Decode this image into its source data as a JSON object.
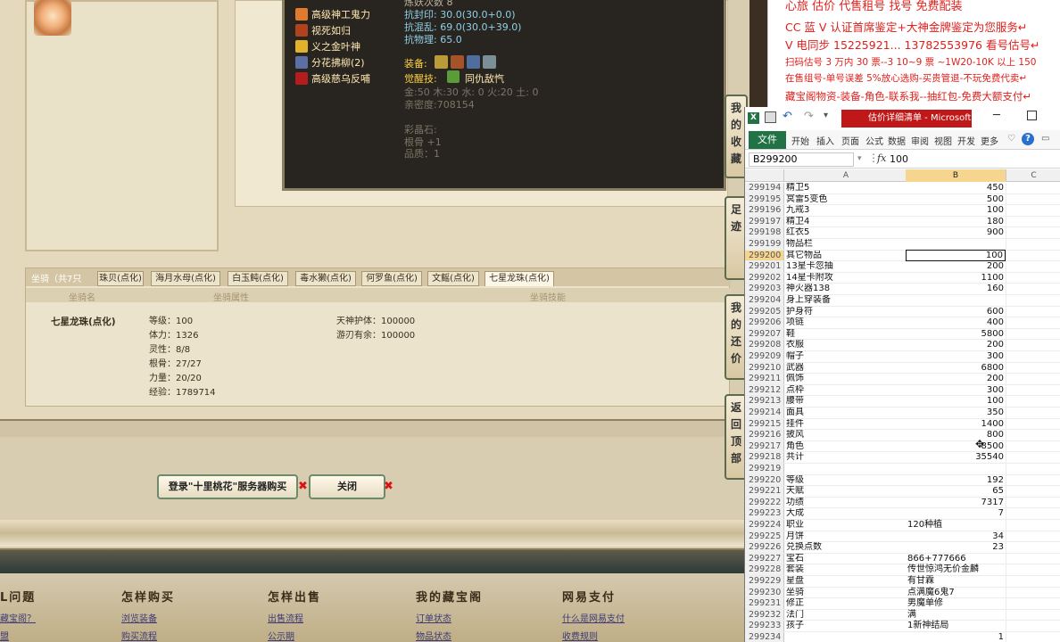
{
  "promo": {
    "line0": "心旅 估价 代售租号 找号 免费配装",
    "line1": "CC 蓝 V 认证首席鉴定+大神金牌鉴定为您服务↵",
    "line2": "V 电同步 15225921... 13782553976 看号估号↵",
    "line3": "扫码估号 3 万内 30 票--3 10~9 票 ~1W20-10K 以上 150",
    "line4": "在售组号-单号误差 5%放心选购-买贵管退-不玩免费代卖↵",
    "line5": "藏宝阁物资-装备-角色-联系我--抽红包-免费大额支付↵"
  },
  "tooltip": {
    "top_partial": "炼妖次数 8",
    "skills": [
      "高级神工鬼力",
      "视死如归",
      "义之金叶神",
      "分花拂柳(2)",
      "高级慈乌反哺"
    ],
    "stats": [
      "抗封印: 30.0(30.0+0.0)",
      "抗混乱: 69.0(30.0+39.0)",
      "抗物理: 65.0"
    ],
    "equip_label": "装备:",
    "awaken_label": "觉醒技:",
    "awaken_value": "同仇敌忾",
    "elements": "金:50 木:30 水: 0 火:20 土: 0",
    "intimacy": "亲密度:708154",
    "crystal_label": "彩晶石:",
    "crystal_1": "根骨 +1",
    "crystal_2": "品质：1"
  },
  "horse": {
    "count_label": "坐骑（共7只",
    "tabs": [
      "珠贝(点化)",
      "海月水母(点化)",
      "白玉鲀(点化)",
      "毒水獭(点化)",
      "何罗鱼(点化)",
      "文鳐(点化)",
      "七星龙珠(点化)"
    ],
    "head": [
      "坐骑名",
      "坐骑属性",
      "坐骑技能"
    ],
    "name": "七星龙珠(点化)",
    "attrs": [
      "等级：100",
      "体力：1326",
      "灵性：8/8",
      "根骨：27/27",
      "力量：20/20",
      "经验：1789714"
    ],
    "skills": [
      "天神护体：100000",
      "游刃有余：100000"
    ]
  },
  "buttons": {
    "buy": "登录\"十里桃花\"服务器购买",
    "close": "关闭"
  },
  "sidetabs": [
    "我的收藏",
    "足迹",
    "我的还价",
    "返回顶部"
  ],
  "footer": {
    "cols": [
      "L问题",
      "怎样购买",
      "怎样出售",
      "我的藏宝阁",
      "网易支付"
    ],
    "links": [
      "藏宝阁？",
      "浏览装备",
      "出售流程",
      "订单状态",
      "什么是网易支付",
      "购买流程",
      "公示期",
      "物品状态",
      "收费规则",
      "盟"
    ]
  },
  "excel": {
    "title": "估价详细清单 - Microsoft...",
    "ribbon": [
      "文件",
      "开始",
      "插入",
      "页面",
      "公式",
      "数据",
      "审阅",
      "视图",
      "开发",
      "更多"
    ],
    "namebox": "B299200",
    "fx": "fx",
    "formula": "100",
    "cols": [
      "A",
      "B",
      "C"
    ],
    "selected_row": "299200",
    "rows": [
      [
        "299194",
        "精卫5",
        "450"
      ],
      [
        "299195",
        "冥雷5变色",
        "500"
      ],
      [
        "299196",
        "九戒3",
        "100"
      ],
      [
        "299197",
        "精卫4",
        "180"
      ],
      [
        "299198",
        "红衣5",
        "900"
      ],
      [
        "299199",
        "物品栏",
        ""
      ],
      [
        "299200",
        "其它物品",
        "100"
      ],
      [
        "299201",
        "13星卡忽抽",
        "200"
      ],
      [
        "299202",
        "14星卡附攻",
        "1100"
      ],
      [
        "299203",
        "神火器138",
        "160"
      ],
      [
        "299204",
        "身上穿装备",
        ""
      ],
      [
        "299205",
        "护身符",
        "600"
      ],
      [
        "299206",
        "项链",
        "400"
      ],
      [
        "299207",
        "鞋",
        "5800"
      ],
      [
        "299208",
        "衣服",
        "200"
      ],
      [
        "299209",
        "帽子",
        "300"
      ],
      [
        "299210",
        "武器",
        "6800"
      ],
      [
        "299211",
        "佩饰",
        "200"
      ],
      [
        "299212",
        "点枠",
        "300"
      ],
      [
        "299213",
        "腰带",
        "100"
      ],
      [
        "299214",
        "面具",
        "350"
      ],
      [
        "299215",
        "挂件",
        "1400"
      ],
      [
        "299216",
        "披风",
        "800"
      ],
      [
        "299217",
        "角色",
        "8500"
      ],
      [
        "299218",
        "共计",
        "35540"
      ],
      [
        "299219",
        "",
        ""
      ],
      [
        "299220",
        "等级",
        "192"
      ],
      [
        "299221",
        "天赋",
        "65"
      ],
      [
        "299222",
        "功绩",
        "7317"
      ],
      [
        "299223",
        "大成",
        "7"
      ],
      [
        "299224",
        "职业",
        "120种植"
      ],
      [
        "299225",
        "月饼",
        "34"
      ],
      [
        "299226",
        "兑换点数",
        "23"
      ],
      [
        "299227",
        "宝石",
        "866+777666"
      ],
      [
        "299228",
        "套装",
        "传世惊鸿无价金麟"
      ],
      [
        "299229",
        "星盘",
        "有甘霖"
      ],
      [
        "299230",
        "坐骑",
        "点满魔6鬼7"
      ],
      [
        "299231",
        "修正",
        "男魔单修"
      ],
      [
        "299232",
        "法门",
        "满"
      ],
      [
        "299233",
        "孩子",
        "1新神结局"
      ],
      [
        "299234",
        "",
        "1"
      ]
    ]
  },
  "colors": {
    "promo_red": "#e0201c",
    "excel_green": "#217346",
    "title_red": "#c01818",
    "sel_yellow": "#f6d58e"
  }
}
